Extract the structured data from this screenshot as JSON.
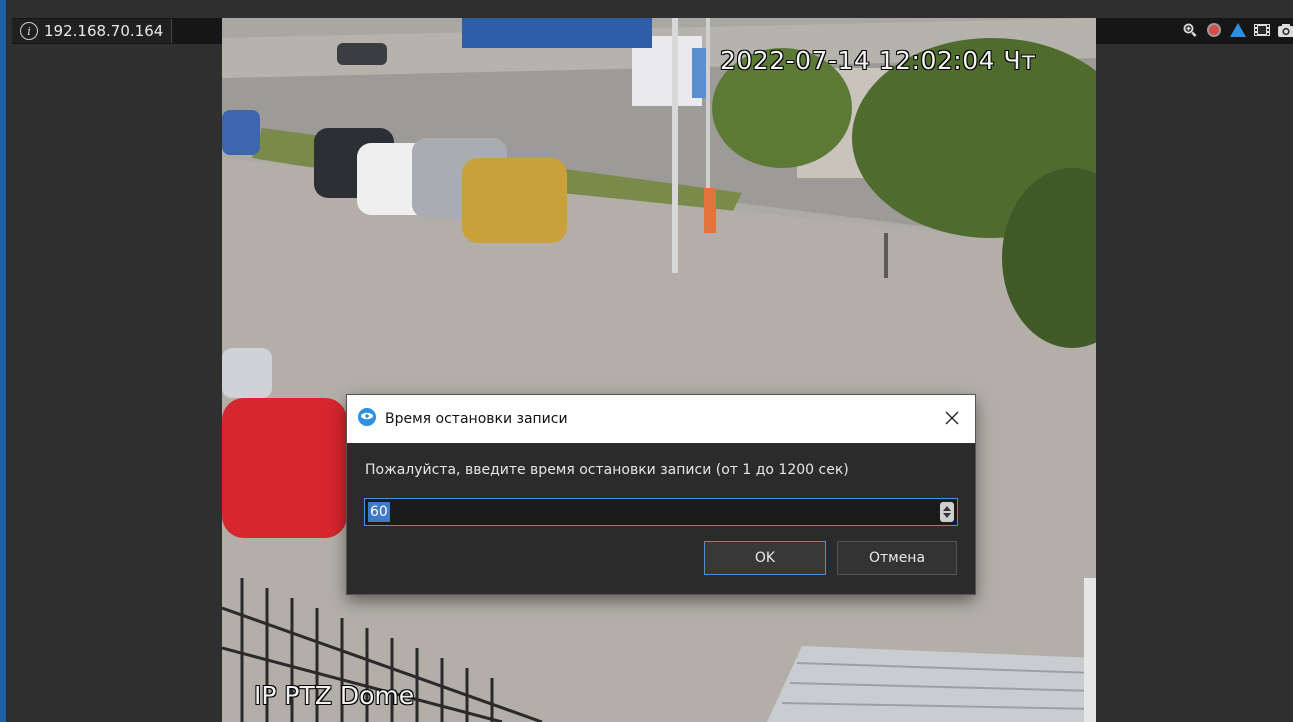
{
  "camera": {
    "ip": "192.168.70.164",
    "osd_datetime": "2022-07-14 12:02:04 Чт",
    "osd_name": "IP PTZ Dome"
  },
  "toolbar": {
    "icons": [
      "zoom-icon",
      "record-icon",
      "alarm-icon",
      "film-icon",
      "snapshot-icon"
    ]
  },
  "dialog": {
    "title": "Время остановки записи",
    "prompt": "Пожалуйста, введите время остановки записи (от 1 до 1200 сек)",
    "value": "60",
    "ok_label": "OK",
    "cancel_label": "Отмена"
  },
  "colors": {
    "accent": "#4a90d9",
    "selection": "#3d7bc6",
    "record": "#d94a4a",
    "alarm": "#2f8fe0"
  }
}
